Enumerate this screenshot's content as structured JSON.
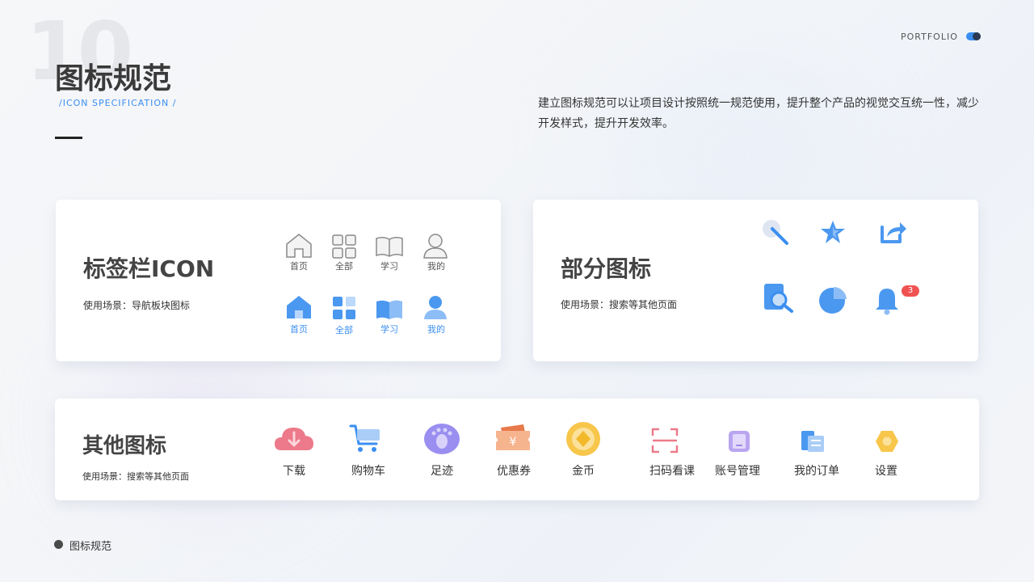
{
  "header": {
    "page_number": "10",
    "title": "图标规范",
    "subtitle": "/ICON SPECIFICATION /",
    "portfolio": "PORTFOLIO",
    "description": "建立图标规范可以让项目设计按照统一规范使用，提升整个产品的视觉交互统一性，减少开发样式，提升开发效率。"
  },
  "tab_card": {
    "title": "标签栏ICON",
    "subtitle": "使用场景：导航板块图标",
    "inactive_items": [
      {
        "label": "首页",
        "icon": "home-outline-icon"
      },
      {
        "label": "全部",
        "icon": "grid-outline-icon"
      },
      {
        "label": "学习",
        "icon": "book-outline-icon"
      },
      {
        "label": "我的",
        "icon": "user-outline-icon"
      }
    ],
    "active_items": [
      {
        "label": "首页",
        "icon": "home-filled-icon"
      },
      {
        "label": "全部",
        "icon": "grid-filled-icon"
      },
      {
        "label": "学习",
        "icon": "book-filled-icon"
      },
      {
        "label": "我的",
        "icon": "user-filled-icon"
      }
    ]
  },
  "partial_card": {
    "title": "部分图标",
    "subtitle": "使用场景：搜索等其他页面",
    "icons": [
      "search-icon",
      "star-icon",
      "share-icon",
      "doc-search-icon",
      "pie-chart-icon",
      "bell-icon"
    ],
    "bell_badge": "3"
  },
  "other_card": {
    "title": "其他图标",
    "subtitle": "使用场景：搜索等其他页面",
    "items": [
      {
        "label": "下载",
        "icon": "cloud-download-icon"
      },
      {
        "label": "购物车",
        "icon": "cart-icon"
      },
      {
        "label": "足迹",
        "icon": "footprint-icon"
      },
      {
        "label": "优惠券",
        "icon": "coupon-icon"
      },
      {
        "label": "金币",
        "icon": "coin-icon"
      },
      {
        "label": "扫码看课",
        "icon": "scan-icon"
      },
      {
        "label": "账号管理",
        "icon": "account-icon"
      },
      {
        "label": "我的订单",
        "icon": "order-icon"
      },
      {
        "label": "设置",
        "icon": "settings-icon"
      }
    ]
  },
  "footer": {
    "label": "图标规范"
  },
  "colors": {
    "accent": "#3a8ef0",
    "grey_icon": "#9a9a9a",
    "badge": "#f05252"
  }
}
